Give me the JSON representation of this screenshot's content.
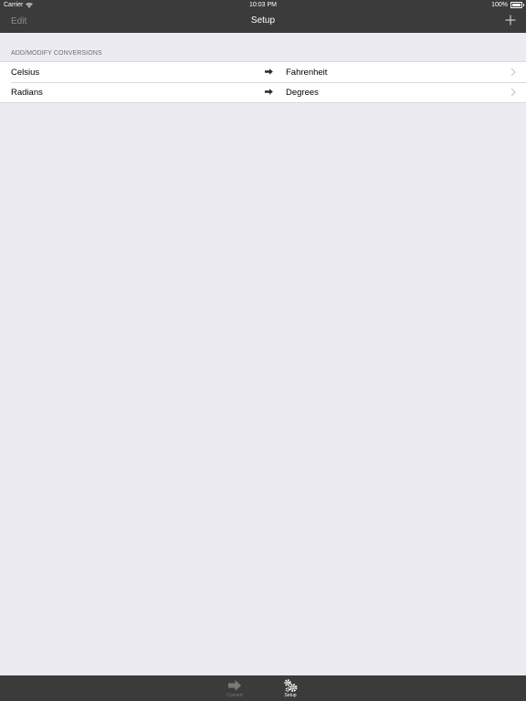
{
  "status_bar": {
    "carrier": "Carrier",
    "time": "10:03 PM",
    "battery": "100%"
  },
  "nav": {
    "edit_label": "Edit",
    "title": "Setup",
    "add_icon": "plus-icon"
  },
  "section": {
    "header": "ADD/MODIFY CONVERSIONS"
  },
  "conversions": [
    {
      "from": "Celsius",
      "to": "Fahrenheit"
    },
    {
      "from": "Radians",
      "to": "Degrees"
    }
  ],
  "tabs": [
    {
      "label": "Convert",
      "icon": "arrow-right-icon",
      "selected": false
    },
    {
      "label": "Setup",
      "icon": "gears-icon",
      "selected": true
    }
  ],
  "colors": {
    "bar_background": "#3b3b3b",
    "page_background": "#ebebf1",
    "disabled_text": "#8e8e8e"
  }
}
